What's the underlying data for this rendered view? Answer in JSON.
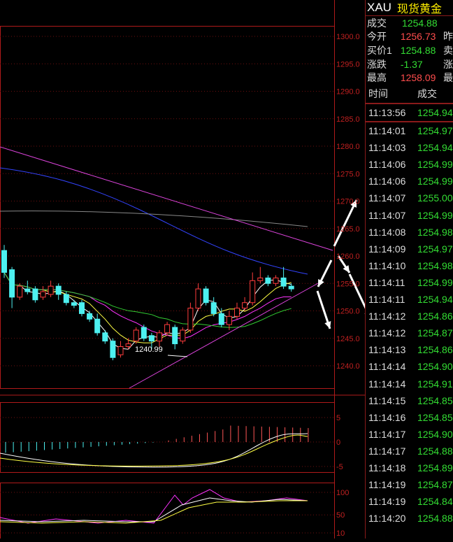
{
  "quote_panel": {
    "symbol": "XAU",
    "name": "现货黄金",
    "rows": [
      {
        "label": "成交",
        "value": "1254.88",
        "color": "#33dd33",
        "extra": ""
      },
      {
        "label": "今开",
        "value": "1256.73",
        "color": "#ff4d4d",
        "extra": "昨"
      },
      {
        "label": "买价1",
        "value": "1254.88",
        "color": "#33dd33",
        "extra": "卖"
      },
      {
        "label": "涨跌",
        "value": "-1.37",
        "color": "#33dd33",
        "extra": "涨"
      },
      {
        "label": "最高",
        "value": "1258.09",
        "color": "#ff4d4d",
        "extra": "最"
      }
    ]
  },
  "ticks": {
    "headers": {
      "time": "时间",
      "price": "成交"
    },
    "rows": [
      {
        "time": "11:13:56",
        "price": "1254.94"
      },
      {
        "time": "11:14:01",
        "price": "1254.97"
      },
      {
        "time": "11:14:03",
        "price": "1254.94"
      },
      {
        "time": "11:14:06",
        "price": "1254.99"
      },
      {
        "time": "11:14:06",
        "price": "1254.99"
      },
      {
        "time": "11:14:07",
        "price": "1255.00"
      },
      {
        "time": "11:14:07",
        "price": "1254.99"
      },
      {
        "time": "11:14:08",
        "price": "1254.98"
      },
      {
        "time": "11:14:09",
        "price": "1254.97"
      },
      {
        "time": "11:14:10",
        "price": "1254.98"
      },
      {
        "time": "11:14:11",
        "price": "1254.99"
      },
      {
        "time": "11:14:11",
        "price": "1254.94"
      },
      {
        "time": "11:14:12",
        "price": "1254.86"
      },
      {
        "time": "11:14:12",
        "price": "1254.87"
      },
      {
        "time": "11:14:13",
        "price": "1254.86"
      },
      {
        "time": "11:14:14",
        "price": "1254.90"
      },
      {
        "time": "11:14:14",
        "price": "1254.91"
      },
      {
        "time": "11:14:15",
        "price": "1254.85"
      },
      {
        "time": "11:14:16",
        "price": "1254.85"
      },
      {
        "time": "11:14:17",
        "price": "1254.90"
      },
      {
        "time": "11:14:17",
        "price": "1254.88"
      },
      {
        "time": "11:14:18",
        "price": "1254.89"
      },
      {
        "time": "11:14:19",
        "price": "1254.87"
      },
      {
        "time": "11:14:19",
        "price": "1254.84"
      },
      {
        "time": "11:14:20",
        "price": "1254.88"
      }
    ]
  },
  "chart_data": [
    {
      "type": "candlestick",
      "ylim": [
        1237.5,
        1302.5
      ],
      "yticks": [
        "1300.0",
        "1295.0",
        "1290.0",
        "1285.0",
        "1280.0",
        "1275.0",
        "1270.0",
        "1265.0",
        "1260.0",
        "1255.0",
        "1250.0",
        "1245.0",
        "1240.0"
      ],
      "low_annotation": "1240.99",
      "candles": [
        [
          1261.0,
          1257.0,
          1262.0,
          1256.0
        ],
        [
          1257.5,
          1252.5,
          1258.0,
          1250.5
        ],
        [
          1252.5,
          1254.5,
          1255.0,
          1252.0
        ],
        [
          1254.0,
          1253.5,
          1255.5,
          1253.0
        ],
        [
          1254.0,
          1252.0,
          1254.5,
          1251.5
        ],
        [
          1252.5,
          1253.5,
          1254.5,
          1252.0
        ],
        [
          1253.0,
          1254.5,
          1255.5,
          1252.5
        ],
        [
          1254.5,
          1253.0,
          1255.0,
          1252.0
        ],
        [
          1253.0,
          1251.5,
          1253.5,
          1251.0
        ],
        [
          1251.5,
          1251.0,
          1252.0,
          1250.5
        ],
        [
          1251.5,
          1249.5,
          1252.0,
          1249.0
        ],
        [
          1249.5,
          1248.5,
          1250.0,
          1248.0
        ],
        [
          1248.5,
          1246.0,
          1249.5,
          1245.5
        ],
        [
          1246.0,
          1244.5,
          1246.5,
          1244.0
        ],
        [
          1244.5,
          1241.5,
          1245.0,
          1241.0
        ],
        [
          1242.0,
          1243.5,
          1244.5,
          1241.5
        ],
        [
          1243.5,
          1244.0,
          1245.0,
          1243.0
        ],
        [
          1244.5,
          1246.5,
          1247.0,
          1244.0
        ],
        [
          1247.0,
          1245.0,
          1247.5,
          1244.5
        ],
        [
          1245.5,
          1244.5,
          1246.0,
          1243.0
        ],
        [
          1244.5,
          1246.0,
          1246.5,
          1243.5
        ],
        [
          1246.0,
          1247.5,
          1248.0,
          1245.5
        ],
        [
          1247.0,
          1244.0,
          1247.5,
          1243.0
        ],
        [
          1244.5,
          1246.5,
          1247.0,
          1244.0
        ],
        [
          1246.5,
          1250.5,
          1251.5,
          1246.0
        ],
        [
          1250.5,
          1254.0,
          1255.0,
          1250.0
        ],
        [
          1254.0,
          1251.5,
          1254.5,
          1251.0
        ],
        [
          1251.5,
          1249.5,
          1252.5,
          1249.0
        ],
        [
          1249.5,
          1247.5,
          1250.5,
          1247.0
        ],
        [
          1247.5,
          1249.0,
          1250.0,
          1246.5
        ],
        [
          1249.0,
          1250.5,
          1251.5,
          1248.5
        ],
        [
          1250.5,
          1251.5,
          1252.5,
          1250.0
        ],
        [
          1251.5,
          1255.5,
          1257.0,
          1251.0
        ],
        [
          1255.5,
          1256.0,
          1258.0,
          1255.0
        ],
        [
          1256.0,
          1255.0,
          1256.5,
          1254.5
        ],
        [
          1255.0,
          1256.0,
          1256.5,
          1254.5
        ],
        [
          1256.0,
          1254.5,
          1258.0,
          1254.0
        ],
        [
          1254.5,
          1254.0,
          1255.0,
          1253.5
        ]
      ]
    },
    {
      "type": "histogram+line",
      "ylim": [
        -5,
        5
      ],
      "yticks": [
        "5",
        "0",
        "-5"
      ]
    },
    {
      "type": "line",
      "ylim": [
        10,
        100
      ],
      "yticks": [
        "100",
        "50",
        "10"
      ]
    }
  ]
}
